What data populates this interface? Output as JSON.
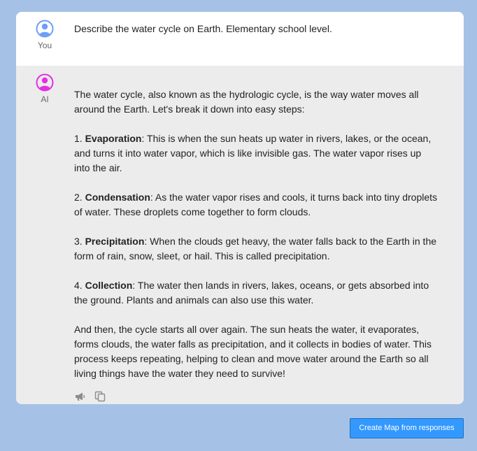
{
  "colors": {
    "background": "#a6c1e6",
    "user_message_bg": "#ffffff",
    "ai_message_bg": "#ececec",
    "user_avatar": "#6f9ef5",
    "ai_avatar": "#e62ee6",
    "button": "#3399ff",
    "icon": "#8c8c8c"
  },
  "user_message": {
    "role": "You",
    "avatar_icon": "user-avatar-icon",
    "text": "Describe the water cycle on Earth. Elementary school level."
  },
  "ai_message": {
    "role": "AI",
    "avatar_icon": "ai-avatar-icon",
    "intro": "The water cycle, also known as the hydrologic cycle, is the way water moves all around the Earth. Let's break it down into easy steps:",
    "steps": [
      {
        "number": "1. ",
        "title": "Evaporation",
        "text": ": This is when the sun heats up water in rivers, lakes, or the ocean, and turns it into water vapor, which is like invisible gas. The water vapor rises up into the air."
      },
      {
        "number": "2. ",
        "title": "Condensation",
        "text": ": As the water vapor rises and cools, it turns back into tiny droplets of water. These droplets come together to form clouds."
      },
      {
        "number": "3. ",
        "title": "Precipitation",
        "text": ": When the clouds get heavy, the water falls back to the Earth in the form of rain, snow, sleet, or hail. This is called precipitation."
      },
      {
        "number": "4. ",
        "title": "Collection",
        "text": ": The water then lands in rivers, lakes, oceans, or gets absorbed into the ground. Plants and animals can also use this water."
      }
    ],
    "conclusion": "And then, the cycle starts all over again. The sun heats the water, it evaporates, forms clouds, the water falls as precipitation, and it collects in bodies of water. This process keeps repeating, helping to clean and move water around the Earth so all living things have the water they need to survive!",
    "action_icons": [
      "megaphone-icon",
      "copy-icon"
    ]
  },
  "footer": {
    "map_button_label": "Create Map from responses"
  }
}
